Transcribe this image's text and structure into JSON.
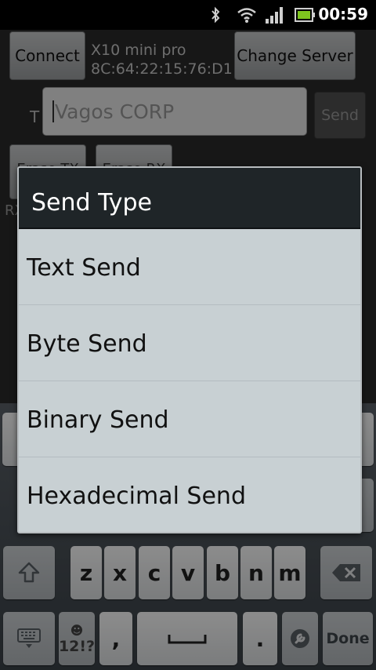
{
  "status_bar": {
    "time": "00:59",
    "icons": [
      "bluetooth-icon",
      "wifi-icon",
      "signal-icon",
      "battery-icon"
    ]
  },
  "app": {
    "connect_label": "Connect",
    "device_name": "X10 mini pro",
    "device_address": "8C:64:22:15:76:D1",
    "change_server_label": "Change Server",
    "text_label": "T",
    "input_value": "Vagos CORP",
    "send_label": "Send",
    "erase_tx_label": "Erase TX",
    "erase_rx_label": "Erase RX",
    "rx_label": "RX"
  },
  "dialog": {
    "title": "Send Type",
    "options": [
      "Text Send",
      "Byte Send",
      "Binary Send",
      "Hexadecimal Send"
    ]
  },
  "keyboard": {
    "row3": [
      "z",
      "x",
      "c",
      "v",
      "b",
      "n",
      "m"
    ],
    "comma": ",",
    "period": ".",
    "symbols_label": "12!?",
    "done_label": "Done"
  },
  "colors": {
    "dialog_title_bg": "#1f2528",
    "dialog_body_bg": "#c8d0d3",
    "keyboard_bg": "#4a5157"
  }
}
